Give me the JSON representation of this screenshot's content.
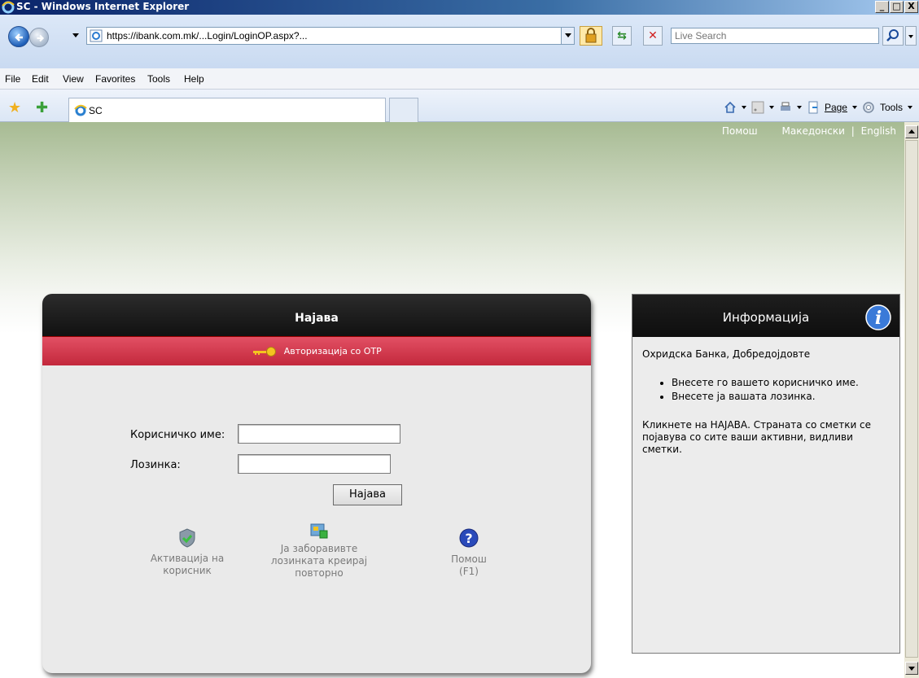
{
  "window": {
    "title": "SC - Windows Internet Explorer",
    "buttons": [
      "_",
      "□",
      "X"
    ]
  },
  "addressbar": {
    "url": "https://ibank.com.mk/...Login/LoginOP.aspx?...",
    "search_placeholder": "Live Search"
  },
  "menu": [
    "File",
    "Edit",
    "View",
    "Favorites",
    "Tools",
    "Help"
  ],
  "tab": {
    "label": "SC"
  },
  "commandbar": {
    "page": "Page",
    "tools": "Tools"
  },
  "toplinks": {
    "help": "Помош",
    "mk": "Македонски",
    "sep": "|",
    "en": "English"
  },
  "login": {
    "title": "Најава",
    "otp": "Авторизација со OTP",
    "username_label": "Корисничко име:",
    "password_label": "Лозинка:",
    "login_button": "Најава",
    "activation_line1": "Активација на",
    "activation_line2": "корисник",
    "forgot_line1": "Ја заборавивте",
    "forgot_line2": "лозинката креирај",
    "forgot_line3": "повторно",
    "help_line1": "Помош",
    "help_line2": "(F1)"
  },
  "info": {
    "title": "Информација",
    "greeting": "Охридска Банка, Добредојдовте",
    "bullets": [
      "Внесете го вашето корисничко име.",
      "Внесете ја вашата лозинка."
    ],
    "footer": "Кликнете на НАЈАВА. Страната со сметки се појавува со сите ваши активни, видливи сметки."
  },
  "colors": {
    "otp_bar": "#d13a4e",
    "header": "#1a1a1a",
    "title_bar": "#0a246a"
  }
}
